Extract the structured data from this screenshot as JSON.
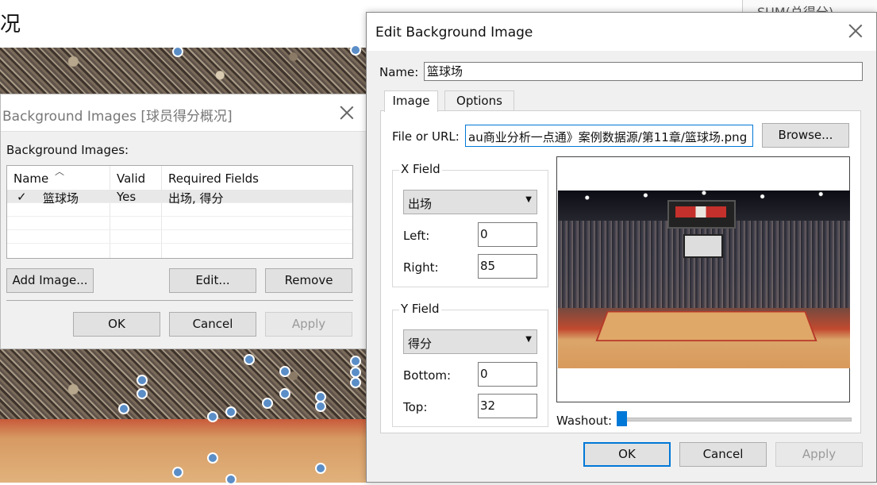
{
  "worksheet": {
    "title_fragment": "况",
    "right_field": "SUM(总得分)"
  },
  "bg_dialog": {
    "title": "Background Images [球员得分概况]",
    "list_label": "Background Images:",
    "columns": [
      "Name",
      "Valid",
      "Required Fields"
    ],
    "rows": [
      {
        "checked": "✓",
        "name": "篮球场",
        "valid": "Yes",
        "required": "出场, 得分"
      }
    ],
    "buttons": {
      "add": "Add Image...",
      "edit": "Edit...",
      "remove": "Remove",
      "ok": "OK",
      "cancel": "Cancel",
      "apply": "Apply"
    }
  },
  "edit_dialog": {
    "title": "Edit Background Image",
    "name_label": "Name:",
    "name_value": "篮球场",
    "tabs": [
      "Image",
      "Options"
    ],
    "file_label": "File or URL:",
    "file_value": "au商业分析一点通》案例数据源/第11章/篮球场.png",
    "browse": "Browse...",
    "x_field": {
      "label": "X Field",
      "selected": "出场",
      "left_label": "Left:",
      "left_value": "0",
      "right_label": "Right:",
      "right_value": "85"
    },
    "y_field": {
      "label": "Y Field",
      "selected": "得分",
      "bottom_label": "Bottom:",
      "bottom_value": "0",
      "top_label": "Top:",
      "top_value": "32"
    },
    "washout_label": "Washout:",
    "washout_value": 0,
    "buttons": {
      "ok": "OK",
      "cancel": "Cancel",
      "apply": "Apply"
    }
  },
  "colors": {
    "accent": "#0078d7",
    "dot": "#5b8ec7"
  }
}
